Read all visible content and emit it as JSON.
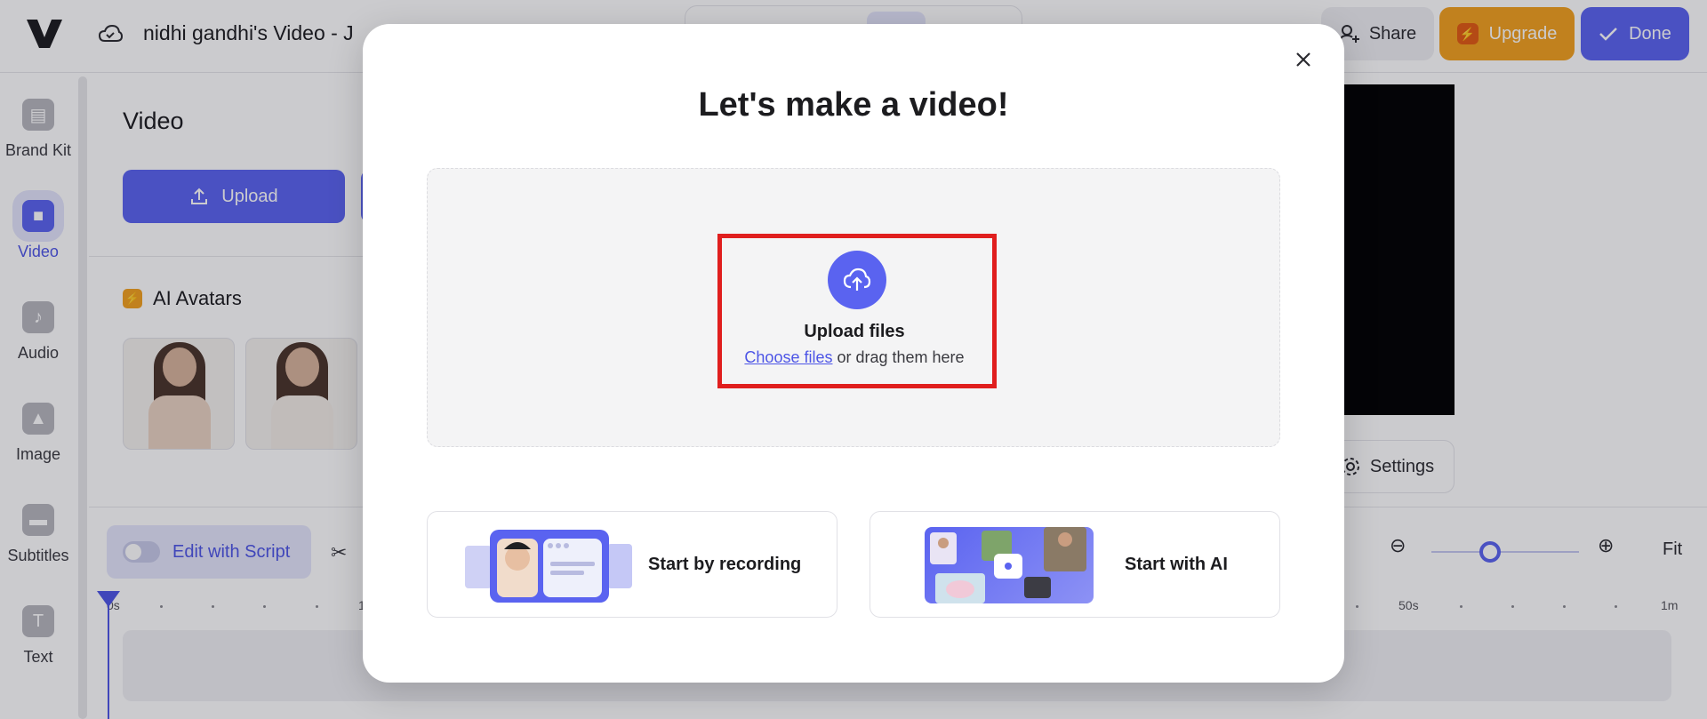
{
  "header": {
    "project_title": "nidhi gandhi's Video - J",
    "share_label": "Share",
    "upgrade_label": "Upgrade",
    "done_label": "Done"
  },
  "sidebar": {
    "items": [
      {
        "label": "Brand Kit",
        "icon": "brand-kit-icon"
      },
      {
        "label": "Video",
        "icon": "video-icon",
        "active": true
      },
      {
        "label": "Audio",
        "icon": "music-note-icon"
      },
      {
        "label": "Image",
        "icon": "image-icon"
      },
      {
        "label": "Subtitles",
        "icon": "subtitles-icon"
      },
      {
        "label": "Text",
        "icon": "text-icon"
      }
    ]
  },
  "panel": {
    "title": "Video",
    "upload_label": "Upload",
    "ai_avatars_heading": "AI Avatars"
  },
  "preview": {
    "settings_label": "Settings"
  },
  "timeline": {
    "edit_with_script_label": "Edit with Script",
    "ruler_labels": [
      "0s",
      "1",
      "50s",
      "1m"
    ],
    "fit_label": "Fit",
    "zoom_level": 0.4
  },
  "modal": {
    "title": "Let's make a video!",
    "upload_title": "Upload files",
    "choose_files_link": "Choose files",
    "drag_text": " or drag them here",
    "start_recording_label": "Start by recording",
    "start_ai_label": "Start with AI"
  },
  "colors": {
    "accent": "#5a63f0",
    "upgrade": "#f3a01e",
    "highlight": "#e01e1e"
  }
}
